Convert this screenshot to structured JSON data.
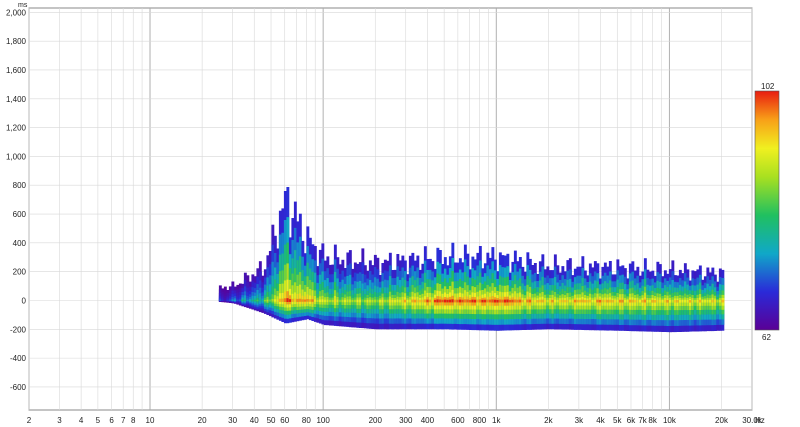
{
  "chart_data": {
    "type": "heatmap",
    "subtype": "spectrogram",
    "x_unit": "Hz",
    "y_unit": "ms",
    "x_scale": "log",
    "xlim": [
      2,
      30000
    ],
    "ylim": [
      -760,
      2030
    ],
    "grid": true,
    "x_tick_labels": [
      {
        "v": 2,
        "t": "2"
      },
      {
        "v": 3,
        "t": "3"
      },
      {
        "v": 4,
        "t": "4"
      },
      {
        "v": 5,
        "t": "5"
      },
      {
        "v": 6,
        "t": "6"
      },
      {
        "v": 7,
        "t": "7"
      },
      {
        "v": 8,
        "t": "8"
      },
      {
        "v": 10,
        "t": "10"
      },
      {
        "v": 20,
        "t": "20"
      },
      {
        "v": 30,
        "t": "30"
      },
      {
        "v": 40,
        "t": "40"
      },
      {
        "v": 50,
        "t": "50"
      },
      {
        "v": 60,
        "t": "60"
      },
      {
        "v": 80,
        "t": "80"
      },
      {
        "v": 100,
        "t": "100"
      },
      {
        "v": 200,
        "t": "200"
      },
      {
        "v": 300,
        "t": "300"
      },
      {
        "v": 400,
        "t": "400"
      },
      {
        "v": 600,
        "t": "600"
      },
      {
        "v": 800,
        "t": "800"
      },
      {
        "v": 1000,
        "t": "1k"
      },
      {
        "v": 2000,
        "t": "2k"
      },
      {
        "v": 3000,
        "t": "3k"
      },
      {
        "v": 4000,
        "t": "4k"
      },
      {
        "v": 5000,
        "t": "5k"
      },
      {
        "v": 6000,
        "t": "6k"
      },
      {
        "v": 7000,
        "t": "7k"
      },
      {
        "v": 8000,
        "t": "8k"
      },
      {
        "v": 10000,
        "t": "10k"
      },
      {
        "v": 20000,
        "t": "20k"
      },
      {
        "v": 30000,
        "t": "30.0k"
      }
    ],
    "y_tick_labels": [
      {
        "v": 2000,
        "t": "2,000"
      },
      {
        "v": 1800,
        "t": "1,800"
      },
      {
        "v": 1600,
        "t": "1,600"
      },
      {
        "v": 1400,
        "t": "1,400"
      },
      {
        "v": 1200,
        "t": "1,200"
      },
      {
        "v": 1000,
        "t": "1,000"
      },
      {
        "v": 800,
        "t": "800"
      },
      {
        "v": 600,
        "t": "600"
      },
      {
        "v": 400,
        "t": "400"
      },
      {
        "v": 200,
        "t": "200"
      },
      {
        "v": 0,
        "t": "0"
      },
      {
        "v": -200,
        "t": "-200"
      },
      {
        "v": -400,
        "t": "-400"
      },
      {
        "v": -600,
        "t": "-600"
      }
    ],
    "colorbar": {
      "min": 62,
      "max": 102,
      "min_label": "62",
      "max_label": "102"
    },
    "color_scale": [
      "#5a0096",
      "#2a2ad8",
      "#10a8c8",
      "#20c060",
      "#a8e020",
      "#f0f020",
      "#f8a018",
      "#e81c10"
    ],
    "profile": [
      {
        "f": 25,
        "top": 90,
        "bottom": -10,
        "peak": 66
      },
      {
        "f": 30,
        "top": 100,
        "bottom": -20,
        "peak": 72
      },
      {
        "f": 45,
        "top": 230,
        "bottom": -90,
        "peak": 80
      },
      {
        "f": 60,
        "top": 700,
        "bottom": -160,
        "peak": 98
      },
      {
        "f": 80,
        "top": 420,
        "bottom": -130,
        "peak": 95
      },
      {
        "f": 100,
        "top": 300,
        "bottom": -170,
        "peak": 88
      },
      {
        "f": 200,
        "top": 260,
        "bottom": -200,
        "peak": 86
      },
      {
        "f": 500,
        "top": 300,
        "bottom": -200,
        "peak": 100
      },
      {
        "f": 1000,
        "top": 300,
        "bottom": -210,
        "peak": 100
      },
      {
        "f": 2000,
        "top": 240,
        "bottom": -200,
        "peak": 92
      },
      {
        "f": 5000,
        "top": 230,
        "bottom": -210,
        "peak": 94
      },
      {
        "f": 10000,
        "top": 210,
        "bottom": -220,
        "peak": 92
      },
      {
        "f": 20000,
        "top": 190,
        "bottom": -210,
        "peak": 90
      }
    ],
    "hotspots_hz": [
      60,
      80,
      450,
      500,
      550,
      1000,
      1100,
      1200,
      3000,
      4000
    ]
  }
}
